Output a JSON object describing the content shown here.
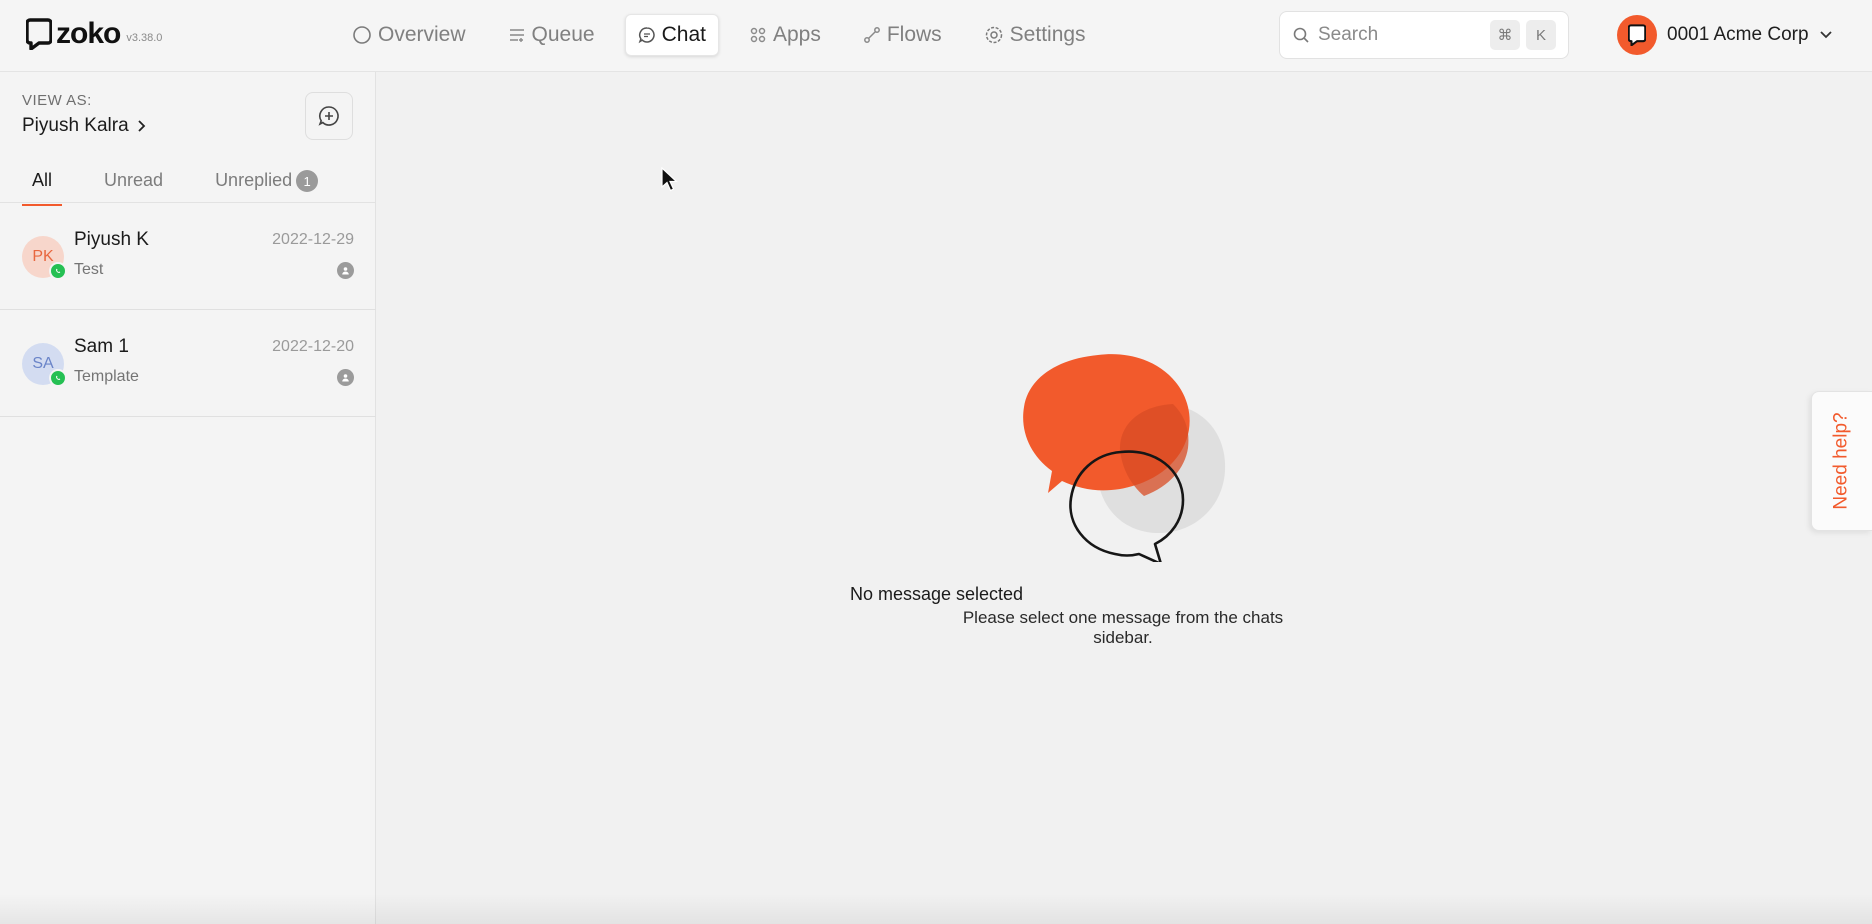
{
  "app": {
    "name": "zoko",
    "version": "v3.38.0"
  },
  "nav": {
    "items": [
      {
        "label": "Overview",
        "icon": "circle-icon"
      },
      {
        "label": "Queue",
        "icon": "queue-icon"
      },
      {
        "label": "Chat",
        "icon": "chat-icon",
        "active": true
      },
      {
        "label": "Apps",
        "icon": "apps-icon"
      },
      {
        "label": "Flows",
        "icon": "flows-icon"
      },
      {
        "label": "Settings",
        "icon": "gear-icon"
      }
    ]
  },
  "search": {
    "placeholder": "Search",
    "shortcut_keys": [
      "⌘",
      "K"
    ]
  },
  "account": {
    "name": "0001 Acme Corp"
  },
  "sidebar": {
    "view_as_label": "VIEW AS:",
    "view_as_user": "Piyush Kalra",
    "tabs": [
      {
        "label": "All",
        "active": true
      },
      {
        "label": "Unread"
      },
      {
        "label": "Unreplied",
        "badge": "1"
      }
    ],
    "chats": [
      {
        "initials": "PK",
        "name": "Piyush K",
        "date": "2022-12-29",
        "preview": "Test",
        "avatar_bg": "#f7d6cb",
        "avatar_fg": "#e8673f"
      },
      {
        "initials": "SA",
        "name": "Sam 1",
        "date": "2022-12-20",
        "preview": "Template",
        "avatar_bg": "#d3dcf1",
        "avatar_fg": "#6a84c8"
      }
    ]
  },
  "empty_state": {
    "title": "No message selected",
    "subtitle": "Please select one message from the chats sidebar."
  },
  "help": {
    "label": "Need help?"
  },
  "colors": {
    "brand": "#f25a2c",
    "whatsapp": "#25c053"
  }
}
